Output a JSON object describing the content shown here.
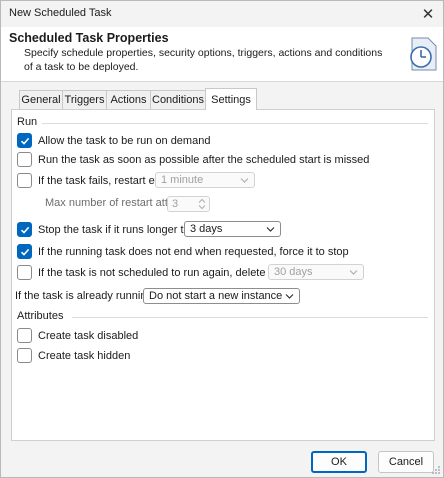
{
  "window": {
    "title": "New Scheduled Task",
    "close_glyph": "✕"
  },
  "header": {
    "title": "Scheduled Task Properties",
    "description": "Specify schedule properties, security options, triggers, actions and conditions of a task to be deployed.",
    "icon": "clock-icon"
  },
  "tabs": [
    {
      "label": "General"
    },
    {
      "label": "Triggers"
    },
    {
      "label": "Actions"
    },
    {
      "label": "Conditions"
    },
    {
      "label": "Settings",
      "active": true
    }
  ],
  "run": {
    "group_label": "Run",
    "allow_on_demand": {
      "label": "Allow the task to be run on demand",
      "checked": true
    },
    "run_asap": {
      "label": "Run the task as soon as possible after the scheduled start is missed",
      "checked": false
    },
    "restart_on_fail": {
      "label": "If the task fails, restart every:",
      "checked": false,
      "value": "1 minute"
    },
    "max_restart": {
      "label": "Max number of restart attemts:",
      "value": "3"
    },
    "stop_if_longer": {
      "label": "Stop the task if it runs longer than:",
      "checked": true,
      "value": "3 days"
    },
    "force_stop": {
      "label": "If the running task does not end when requested, force it to stop",
      "checked": true
    },
    "delete_after": {
      "label": "If the task is not scheduled to run again, delete it after:",
      "checked": false,
      "value": "30 days"
    },
    "already_running": {
      "label": "If the task is already running:",
      "value": "Do not start a new instance"
    }
  },
  "attributes": {
    "group_label": "Attributes",
    "create_disabled": {
      "label": "Create task disabled",
      "checked": false
    },
    "create_hidden": {
      "label": "Create task hidden",
      "checked": false
    }
  },
  "buttons": {
    "ok": "OK",
    "cancel": "Cancel"
  },
  "colors": {
    "accent": "#0067c0"
  }
}
